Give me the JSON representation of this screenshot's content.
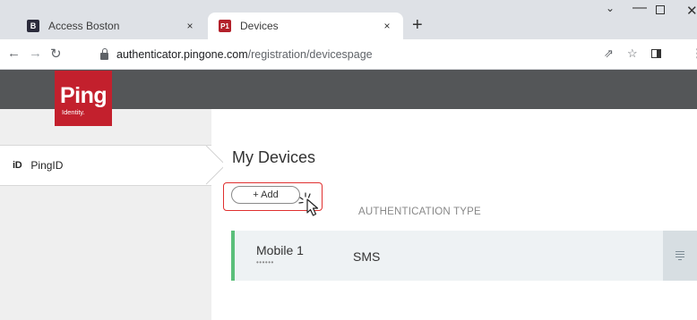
{
  "browser": {
    "tabs": [
      {
        "favicon": "B",
        "title": "Access Boston",
        "close": "×"
      },
      {
        "favicon": "P1",
        "title": "Devices",
        "close": "×"
      }
    ],
    "new_tab": "+",
    "address": {
      "domain": "authenticator.pingone.com",
      "path": "/registration/devicespage"
    }
  },
  "app": {
    "logo": {
      "word": "Ping",
      "sub": "Identity."
    },
    "sidebar": {
      "items": [
        {
          "icon_text": "iD",
          "label": "PingID"
        }
      ]
    },
    "main": {
      "title": "My Devices",
      "add_button": "+ Add",
      "column_header": "AUTHENTICATION TYPE",
      "devices": [
        {
          "name": "Mobile 1",
          "masked": "••••••",
          "type": "SMS"
        }
      ]
    }
  },
  "colors": {
    "ping_red": "#c3202d",
    "header_gray": "#545658",
    "device_accent": "#5bbf7a",
    "highlight_red": "#e0302f"
  }
}
